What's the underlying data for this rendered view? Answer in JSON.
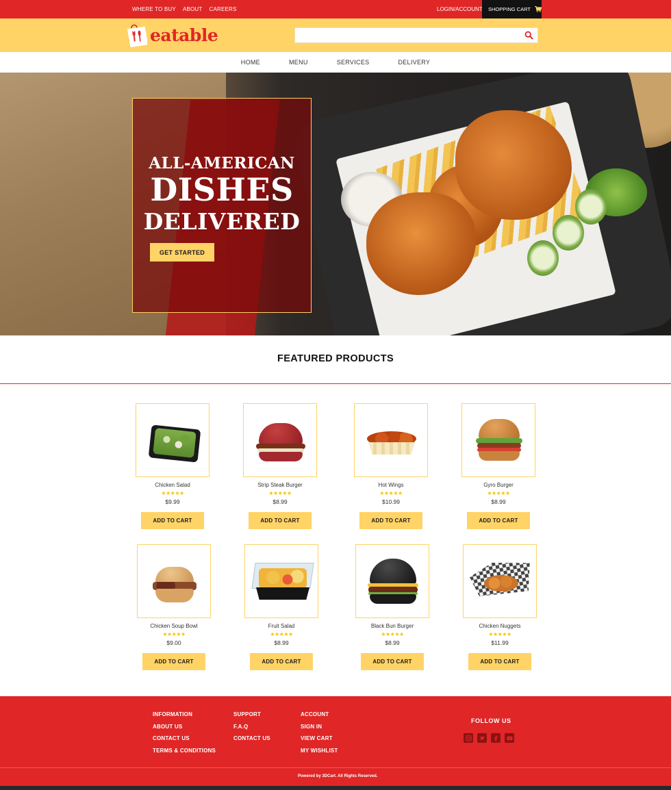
{
  "topbar": {
    "links": [
      "WHERE TO BUY",
      "ABOUT",
      "CAREERS"
    ],
    "login": "LOGIN/ACCOUNT",
    "cart": "SHOPPING CART"
  },
  "header": {
    "logo_text": "eatable",
    "search_placeholder": ""
  },
  "nav": [
    "HOME",
    "MENU",
    "SERVICES",
    "DELIVERY"
  ],
  "hero": {
    "line1": "ALL-AMERICAN",
    "line2": "DISHES",
    "line3": "DELIVERED",
    "cta": "GET STARTED"
  },
  "featured": {
    "title": "FEATURED PRODUCTS",
    "add_to_cart": "ADD TO CART",
    "stars": "★★★★★",
    "products": [
      {
        "name": "Chicken Salad",
        "price": "$9.99",
        "rating": 5
      },
      {
        "name": "Strip Steak Burger",
        "price": "$8.99",
        "rating": 5
      },
      {
        "name": "Hot Wings",
        "price": "$10.99",
        "rating": 5
      },
      {
        "name": "Gyro Burger",
        "price": "$8.99",
        "rating": 5
      },
      {
        "name": "Chicken Soup Bowl",
        "price": "$9.00",
        "rating": 5
      },
      {
        "name": "Fruit Salad",
        "price": "$8.99",
        "rating": 5
      },
      {
        "name": "Black Bun Burger",
        "price": "$8.99",
        "rating": 5
      },
      {
        "name": "Chicken Nuggets",
        "price": "$11.99",
        "rating": 5
      }
    ]
  },
  "footer": {
    "col1": [
      "INFORMATION",
      "ABOUT US",
      "CONTACT US",
      "TERMS & CONDITIONS"
    ],
    "col2": [
      "SUPPORT",
      "F.A.Q",
      "CONTACT US"
    ],
    "col3": [
      "ACCOUNT",
      "SIGN IN",
      "VIEW CART",
      "MY WISHLIST"
    ],
    "follow": "FOLLOW US",
    "social_icons": [
      "instagram-icon",
      "twitter-icon",
      "facebook-icon",
      "youtube-icon"
    ],
    "copyright": "Powered by 3DCart. All Rights Reserved."
  },
  "colors": {
    "brand_red": "#e02626",
    "brand_yellow": "#ffd366",
    "cart_black": "#121212",
    "star": "#f7c400"
  }
}
